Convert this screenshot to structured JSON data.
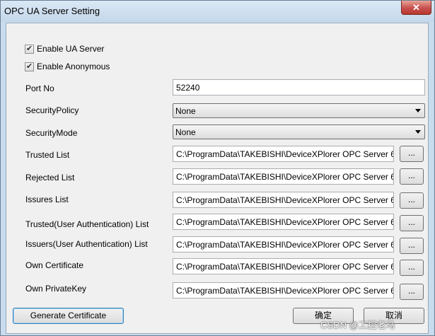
{
  "window": {
    "title": "OPC UA Server Setting",
    "close_glyph": "✕"
  },
  "checkboxes": [
    {
      "label": "Enable UA Server",
      "checked": true
    },
    {
      "label": "Enable Anonymous",
      "checked": true
    }
  ],
  "port": {
    "label": "Port No",
    "value": "52240"
  },
  "security_policy": {
    "label": "SecurityPolicy",
    "value": "None"
  },
  "security_mode": {
    "label": "SecurityMode",
    "value": "None"
  },
  "paths": [
    {
      "label": "Trusted List",
      "value": "C:\\ProgramData\\TAKEBISHI\\DeviceXPlorer OPC Server 6"
    },
    {
      "label": "Rejected List",
      "value": "C:\\ProgramData\\TAKEBISHI\\DeviceXPlorer OPC Server 6"
    },
    {
      "label": "Issures List",
      "value": "C:\\ProgramData\\TAKEBISHI\\DeviceXPlorer OPC Server 6"
    },
    {
      "label": "Trusted(User Authentication) List",
      "value": "C:\\ProgramData\\TAKEBISHI\\DeviceXPlorer OPC Server 6"
    },
    {
      "label": "Issuers(User Authentication) List",
      "value": "C:\\ProgramData\\TAKEBISHI\\DeviceXPlorer OPC Server 6"
    },
    {
      "label": "Own Certificate",
      "value": "C:\\ProgramData\\TAKEBISHI\\DeviceXPlorer OPC Server 6"
    },
    {
      "label": "Own PrivateKey",
      "value": "C:\\ProgramData\\TAKEBISHI\\DeviceXPlorer OPC Server 6"
    }
  ],
  "browse_label": "...",
  "buttons": {
    "generate": "Generate Certificate",
    "ok": "确定",
    "cancel": "取消"
  },
  "watermark": "CSDN @工控老马",
  "check_glyph": "✔"
}
